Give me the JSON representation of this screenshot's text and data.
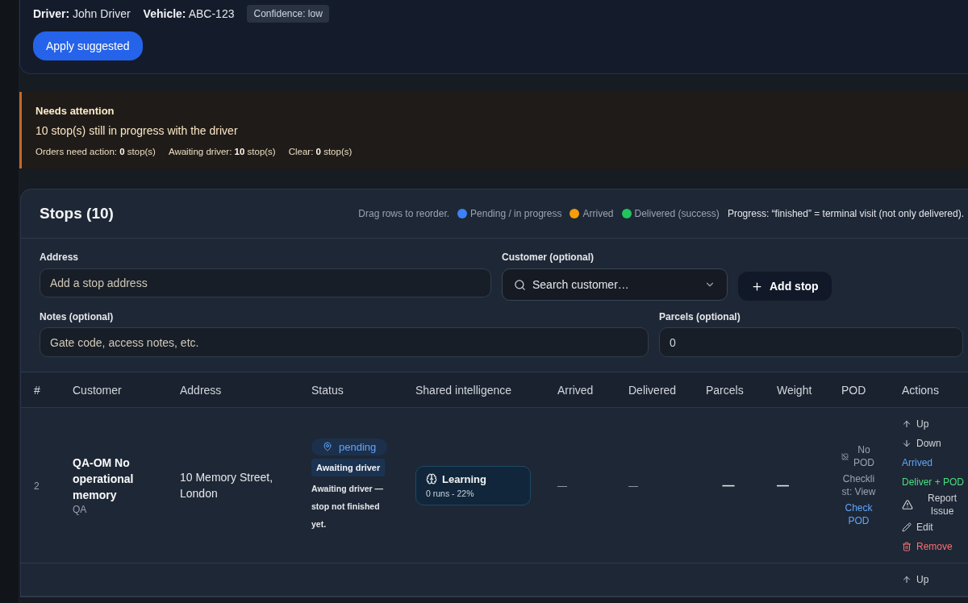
{
  "assignment": {
    "driver": "**Driver:** John Driver",
    "vehicle": "**Vehicle:** ABC-123",
    "confidence": "Confidence: low",
    "apply_button": "Apply suggested"
  },
  "attention": {
    "title": "Needs attention",
    "message": "10 stop(s) still in progress with the driver",
    "summary": [
      "Orders need action: **0** stop(s)",
      "Awaiting driver: **10** stop(s)",
      "Clear: **0** stop(s)"
    ]
  },
  "stops": {
    "title": "Stops (10)",
    "hint": "Drag rows to reorder.",
    "legend": [
      {
        "label": "Pending / in progress",
        "color": "#3b82f6"
      },
      {
        "label": "Arrived",
        "color": "#f59e0b"
      },
      {
        "label": "Delivered (success)",
        "color": "#22c55e"
      }
    ],
    "progress_note": "Progress: “finished” = terminal visit (not only delivered).",
    "form": {
      "address": {
        "label": "Address",
        "placeholder": "Add a stop address"
      },
      "customer": {
        "label": "Customer (optional)",
        "placeholder": "Search customer…"
      },
      "add_button": "Add stop",
      "notes": {
        "label": "Notes (optional)",
        "placeholder": "Gate code, access notes, etc."
      },
      "parcels": {
        "label": "Parcels (optional)",
        "value": "0"
      }
    },
    "table": {
      "columns": [
        "#",
        "Customer",
        "Address",
        "Status",
        "Shared intelligence",
        "Arrived",
        "Delivered",
        "Parcels",
        "Weight",
        "POD",
        "Actions"
      ],
      "rows": [
        {
          "number": "2",
          "customer": "QA-OM No operational memory",
          "customer_code": "QA",
          "address": "10 Memory Street, London",
          "status": {
            "kind": "pending",
            "label": "pending"
          },
          "status_tag": "Awaiting driver",
          "status_note": "Awaiting driver — stop not finished yet.",
          "intelligence": {
            "title": "Learning",
            "detail": "0 runs - 22%"
          },
          "arrived": "—",
          "delivered": "—",
          "parcels": "—",
          "weight": "—",
          "pod": {
            "status": "No POD",
            "checklist": "Checklist: View",
            "link": "Check POD"
          },
          "actions": [
            {
              "kind": "up",
              "label": "Up"
            },
            {
              "kind": "down",
              "label": "Down"
            },
            {
              "kind": "arrived",
              "label": "Arrived"
            },
            {
              "kind": "deliver",
              "label": "Deliver + POD"
            },
            {
              "kind": "report",
              "label": "Report Issue"
            },
            {
              "kind": "edit",
              "label": "Edit"
            },
            {
              "kind": "remove",
              "label": "Remove"
            }
          ]
        },
        {
          "actions": [
            {
              "kind": "up",
              "label": "Up"
            }
          ]
        }
      ]
    }
  }
}
